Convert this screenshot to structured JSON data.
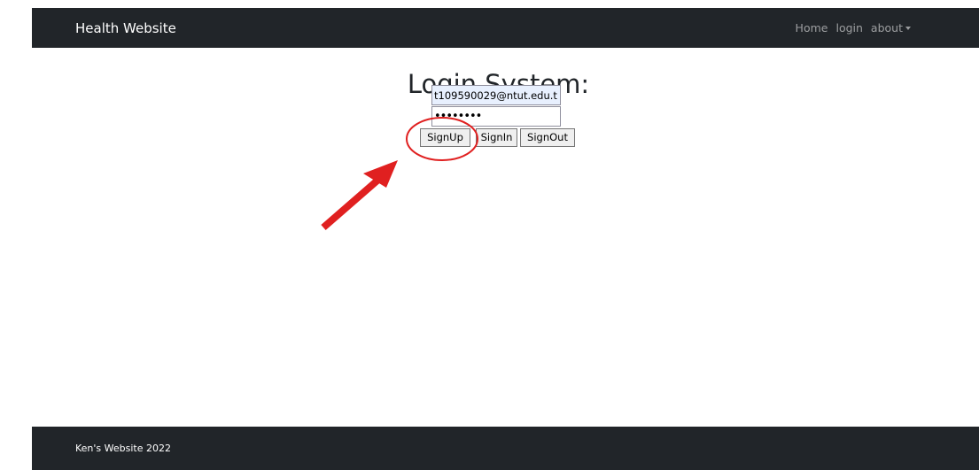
{
  "navbar": {
    "brand": "Health Website",
    "links": [
      {
        "label": "Home"
      },
      {
        "label": "login"
      },
      {
        "label": "about"
      }
    ]
  },
  "main": {
    "title": "Login System:",
    "email_value": "t109590029@ntut.edu.t",
    "password_value": "password",
    "buttons": {
      "signup": "SignUp",
      "signin": "SignIn",
      "signout": "SignOut"
    }
  },
  "annotation": {
    "color": "#e02020"
  },
  "footer": {
    "text": "Ken's Website 2022"
  },
  "colors": {
    "navbar_bg": "#212529",
    "autofill_bg": "#e8f0fe"
  }
}
